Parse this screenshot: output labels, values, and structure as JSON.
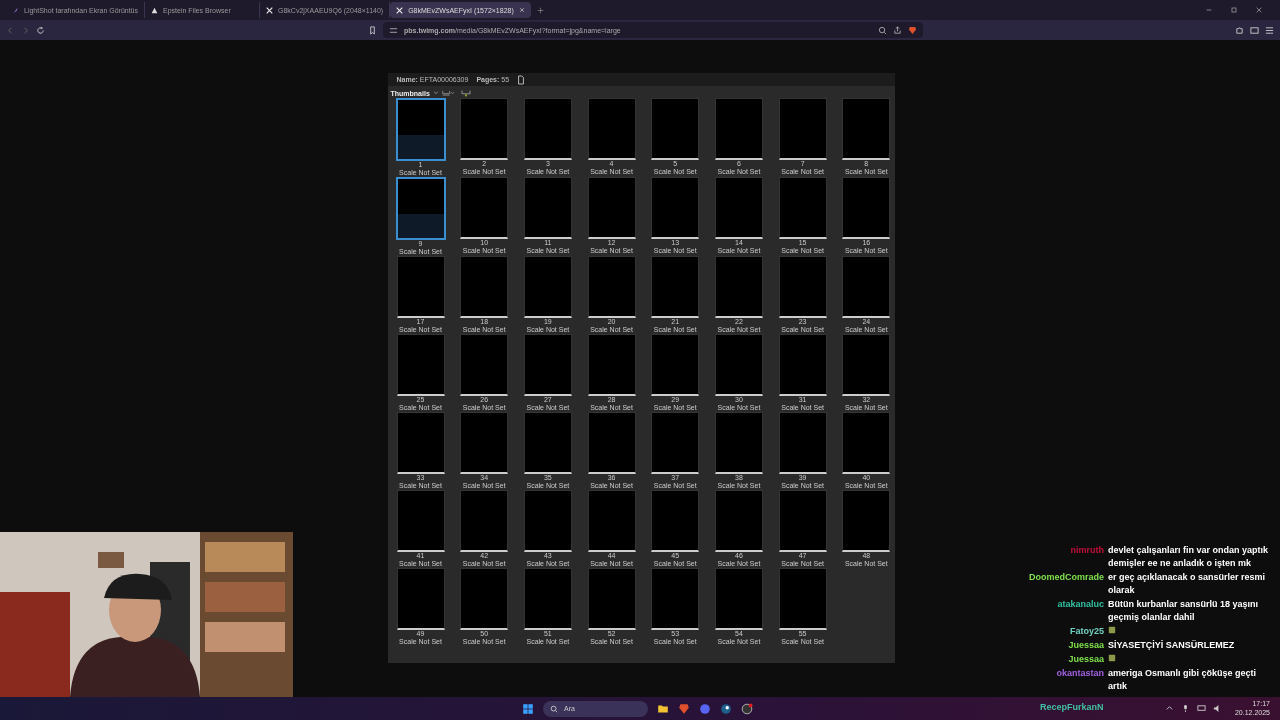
{
  "tabs": [
    {
      "label": "LightShot tarafından Ekran Görüntüs",
      "selected": false
    },
    {
      "label": "Epstein Files Browser",
      "selected": false
    },
    {
      "label": "G8kCv2jXAAEU9Q6 (2048×1140)",
      "selected": false
    },
    {
      "label": "G8kMEvZWsAEFyxI (1572×1828)",
      "selected": true
    }
  ],
  "address_bar": {
    "url": "**pbs.twimg.com**/media/G8kMEvZWsAEFyxI?format=jpg&name=large"
  },
  "viewer": {
    "name": "**Name:** EFTA00006309",
    "pages": "**Pages:** 55",
    "panel_title": "Thumbnails",
    "thumbnails": [
      {
        "number": "1",
        "caption": "Scale Not Set",
        "selected": true
      },
      {
        "number": "2",
        "caption": "Scale Not Set",
        "selected": false
      },
      {
        "number": "3",
        "caption": "Scale Not Set",
        "selected": false
      },
      {
        "number": "4",
        "caption": "Scale Not Set",
        "selected": false
      },
      {
        "number": "5",
        "caption": "Scale Not Set",
        "selected": false
      },
      {
        "number": "6",
        "caption": "Scale Not Set",
        "selected": false
      },
      {
        "number": "7",
        "caption": "Scale Not Set",
        "selected": false
      },
      {
        "number": "8",
        "caption": "Scale Not Set",
        "selected": false
      },
      {
        "number": "9",
        "caption": "Scale Not Set",
        "selected": true
      },
      {
        "number": "10",
        "caption": "Scale Not Set",
        "selected": false
      },
      {
        "number": "11",
        "caption": "Scale Not Set",
        "selected": false
      },
      {
        "number": "12",
        "caption": "Scale Not Set",
        "selected": false
      },
      {
        "number": "13",
        "caption": "Scale Not Set",
        "selected": false
      },
      {
        "number": "14",
        "caption": "Scale Not Set",
        "selected": false
      },
      {
        "number": "15",
        "caption": "Scale Not Set",
        "selected": false
      },
      {
        "number": "16",
        "caption": "Scale Not Set",
        "selected": false
      },
      {
        "number": "17",
        "caption": "Scale Not Set",
        "selected": false
      },
      {
        "number": "18",
        "caption": "Scale Not Set",
        "selected": false
      },
      {
        "number": "19",
        "caption": "Scale Not Set",
        "selected": false
      },
      {
        "number": "20",
        "caption": "Scale Not Set",
        "selected": false
      },
      {
        "number": "21",
        "caption": "Scale Not Set",
        "selected": false
      },
      {
        "number": "22",
        "caption": "Scale Not Set",
        "selected": false
      },
      {
        "number": "23",
        "caption": "Scale Not Set",
        "selected": false
      },
      {
        "number": "24",
        "caption": "Scale Not Set",
        "selected": false
      },
      {
        "number": "25",
        "caption": "Scale Not Set",
        "selected": false
      },
      {
        "number": "26",
        "caption": "Scale Not Set",
        "selected": false
      },
      {
        "number": "27",
        "caption": "Scale Not Set",
        "selected": false
      },
      {
        "number": "28",
        "caption": "Scale Not Set",
        "selected": false
      },
      {
        "number": "29",
        "caption": "Scale Not Set",
        "selected": false
      },
      {
        "number": "30",
        "caption": "Scale Not Set",
        "selected": false
      },
      {
        "number": "31",
        "caption": "Scale Not Set",
        "selected": false
      },
      {
        "number": "32",
        "caption": "Scale Not Set",
        "selected": false
      },
      {
        "number": "33",
        "caption": "Scale Not Set",
        "selected": false
      },
      {
        "number": "34",
        "caption": "Scale Not Set",
        "selected": false
      },
      {
        "number": "35",
        "caption": "Scale Not Set",
        "selected": false
      },
      {
        "number": "36",
        "caption": "Scale Not Set",
        "selected": false
      },
      {
        "number": "37",
        "caption": "Scale Not Set",
        "selected": false
      },
      {
        "number": "38",
        "caption": "Scale Not Set",
        "selected": false
      },
      {
        "number": "39",
        "caption": "Scale Not Set",
        "selected": false
      },
      {
        "number": "40",
        "caption": "Scale Not Set",
        "selected": false
      },
      {
        "number": "41",
        "caption": "Scale Not Set",
        "selected": false
      },
      {
        "number": "42",
        "caption": "Scale Not Set",
        "selected": false
      },
      {
        "number": "43",
        "caption": "Scale Not Set",
        "selected": false
      },
      {
        "number": "44",
        "caption": "Scale Not Set",
        "selected": false
      },
      {
        "number": "45",
        "caption": "Scale Not Set",
        "selected": false
      },
      {
        "number": "46",
        "caption": "Scale Not Set",
        "selected": false
      },
      {
        "number": "47",
        "caption": "Scale Not Set",
        "selected": false
      },
      {
        "number": "48",
        "caption": "Scale Not Set",
        "selected": false
      },
      {
        "number": "49",
        "caption": "Scale Not Set",
        "selected": false
      },
      {
        "number": "50",
        "caption": "Scale Not Set",
        "selected": false
      },
      {
        "number": "51",
        "caption": "Scale Not Set",
        "selected": false
      },
      {
        "number": "52",
        "caption": "Scale Not Set",
        "selected": false
      },
      {
        "number": "53",
        "caption": "Scale Not Set",
        "selected": false
      },
      {
        "number": "54",
        "caption": "Scale Not Set",
        "selected": false
      },
      {
        "number": "55",
        "caption": "Scale Not Set",
        "selected": false
      }
    ]
  },
  "chat": [
    {
      "user": "nimruth",
      "color": "#c0103a",
      "kind": "text",
      "message": "devlet çalışanları fin var ondan yaptık demişler ee ne anladık o işten mk"
    },
    {
      "user": "DoomedComrade",
      "color": "#7ee04a",
      "kind": "text",
      "message": "er geç açıklanacak o sansürler resmi olarak"
    },
    {
      "user": "atakanaluc",
      "color": "#2fc0a0",
      "kind": "text",
      "message": "Bütün kurbanlar sansürlü 18 yaşını geçmiş olanlar dahil"
    },
    {
      "user": "Fatoy25",
      "color": "#6fd0c0",
      "kind": "emote"
    },
    {
      "user": "Juessaa",
      "color": "#7ee04a",
      "kind": "text",
      "message": "SİYASETÇİYİ SANSÜRLEMEZ"
    },
    {
      "user": "Juessaa",
      "color": "#7ee04a",
      "kind": "emote"
    },
    {
      "user": "okantastan",
      "color": "#a060e0",
      "kind": "text",
      "message": "ameriga Osmanlı gibi çöküşe geçti artık"
    }
  ],
  "streamer_name": "RecepFurkanN",
  "taskbar": {
    "search": {
      "placeholder": "Ara"
    },
    "time": "17:17",
    "date": "20.12.2025"
  }
}
